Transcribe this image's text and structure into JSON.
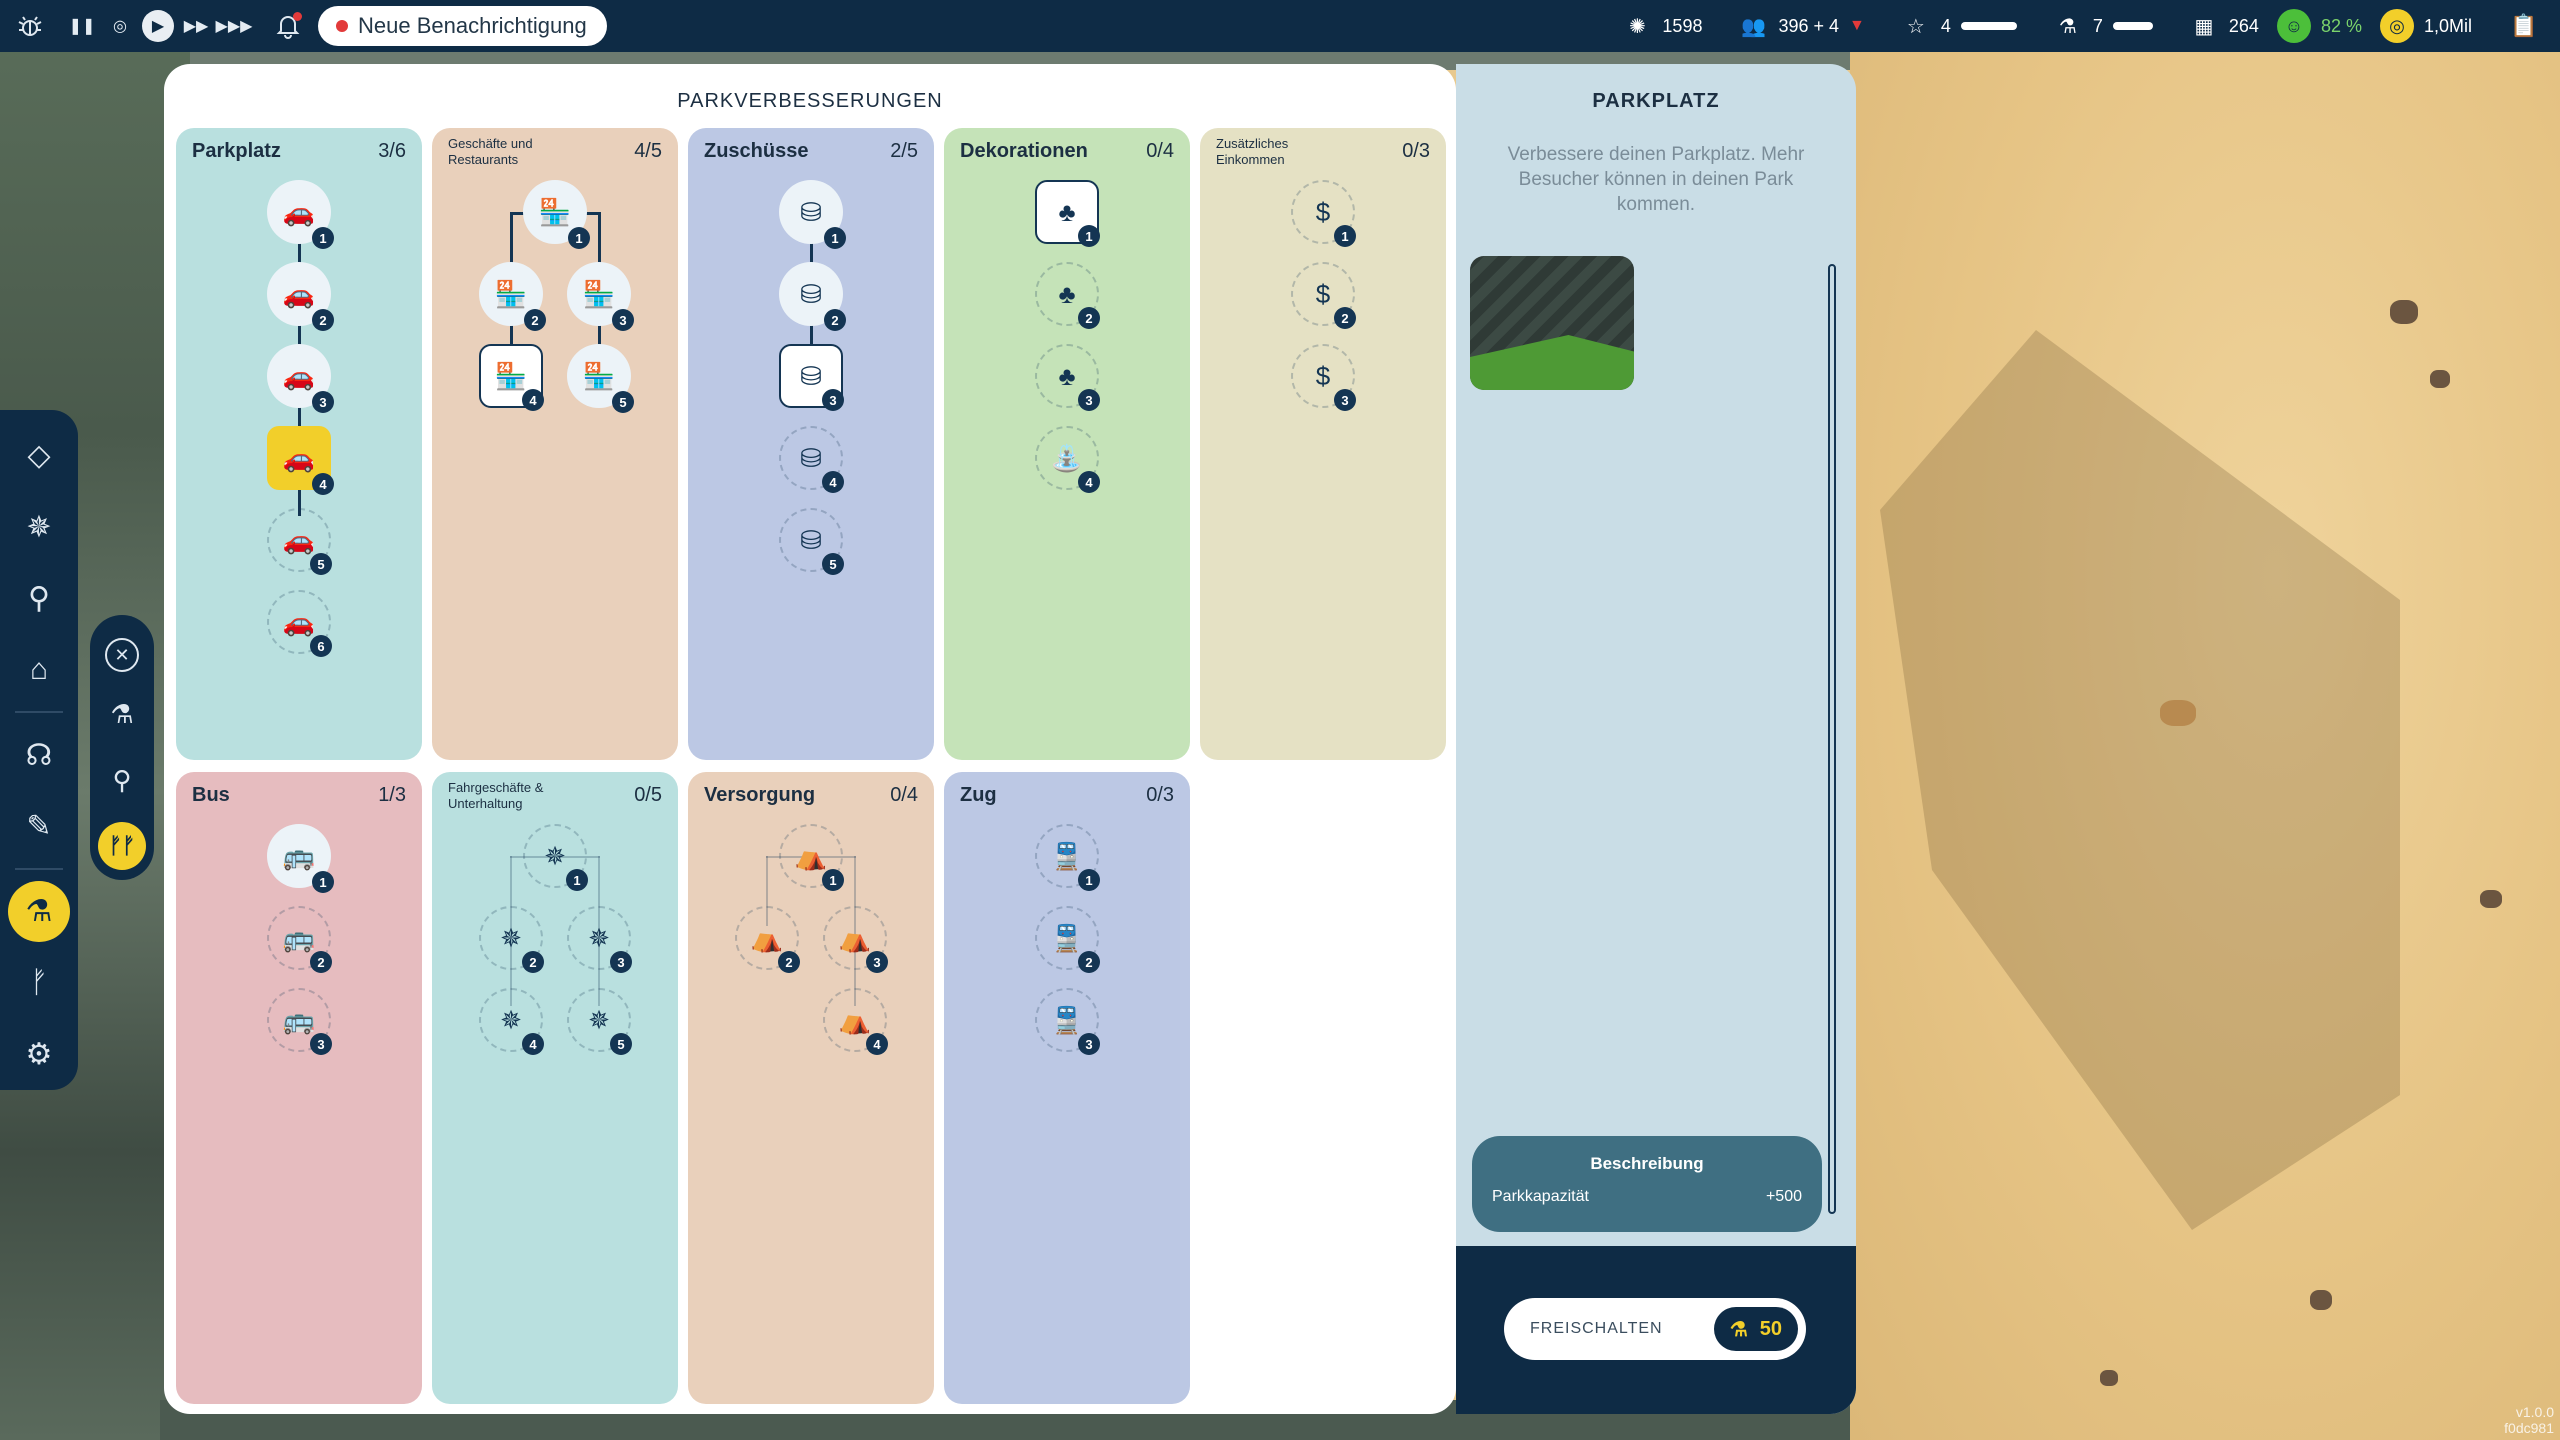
{
  "topbar": {
    "notification": "Neue Benachrichtigung",
    "stats": {
      "research": "1598",
      "visitors": "396 + 4",
      "rating": "4",
      "scientists": "7",
      "day": "264",
      "happiness": "82 %",
      "money": "1,0Mil"
    }
  },
  "panel": {
    "title": "PARKVERBESSERUNGEN",
    "columns": [
      {
        "name": "Parkplatz",
        "count": "3/6",
        "icon": "car-icon"
      },
      {
        "name": "Geschäfte und Restaurants",
        "count": "4/5",
        "icon": "shop-icon"
      },
      {
        "name": "Zuschüsse",
        "count": "2/5",
        "icon": "coins-icon"
      },
      {
        "name": "Dekorationen",
        "count": "0/4",
        "icon": "tree-icon"
      },
      {
        "name": "Zusätzliches Einkommen",
        "count": "0/3",
        "icon": "dollar-icon"
      },
      {
        "name": "Bus",
        "count": "1/3",
        "icon": "bus-icon"
      },
      {
        "name": "Fahrgeschäfte & Unterhaltung",
        "count": "0/5",
        "icon": "ferris-wheel-icon"
      },
      {
        "name": "Versorgung",
        "count": "0/4",
        "icon": "stall-icon"
      },
      {
        "name": "Zug",
        "count": "0/3",
        "icon": "train-icon"
      }
    ]
  },
  "detail": {
    "title": "PARKPLATZ",
    "text": "Verbessere deinen Parkplatz. Mehr Besucher können in deinen Park kommen.",
    "desc_title": "Beschreibung",
    "desc_label": "Parkkapazität",
    "desc_value": "+500",
    "unlock_label": "FREISCHALTEN",
    "unlock_cost": "50"
  },
  "version": "v1.0.0\nf0dc981",
  "colors": {
    "navy": "#0e2b45",
    "accent": "#f2cf2a",
    "parkplatz": "#b9e0df",
    "shops": "#e9d0bb",
    "subsidies": "#bcc8e4",
    "decorations": "#c5e3b8",
    "income": "#e5e1c4",
    "bus": "#e6bcbf",
    "rides": "#b9e0df",
    "supply": "#e9d0bb",
    "train": "#bcc8e4"
  }
}
